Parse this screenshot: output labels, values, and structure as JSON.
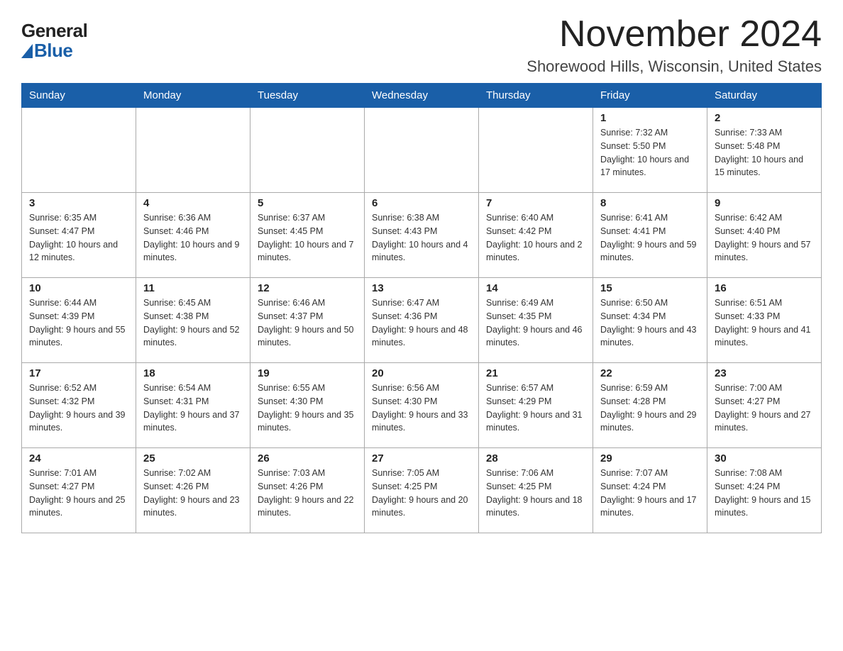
{
  "logo": {
    "general": "General",
    "blue": "Blue"
  },
  "header": {
    "month": "November 2024",
    "location": "Shorewood Hills, Wisconsin, United States"
  },
  "weekdays": [
    "Sunday",
    "Monday",
    "Tuesday",
    "Wednesday",
    "Thursday",
    "Friday",
    "Saturday"
  ],
  "weeks": [
    [
      {
        "day": "",
        "info": ""
      },
      {
        "day": "",
        "info": ""
      },
      {
        "day": "",
        "info": ""
      },
      {
        "day": "",
        "info": ""
      },
      {
        "day": "",
        "info": ""
      },
      {
        "day": "1",
        "info": "Sunrise: 7:32 AM\nSunset: 5:50 PM\nDaylight: 10 hours and 17 minutes."
      },
      {
        "day": "2",
        "info": "Sunrise: 7:33 AM\nSunset: 5:48 PM\nDaylight: 10 hours and 15 minutes."
      }
    ],
    [
      {
        "day": "3",
        "info": "Sunrise: 6:35 AM\nSunset: 4:47 PM\nDaylight: 10 hours and 12 minutes."
      },
      {
        "day": "4",
        "info": "Sunrise: 6:36 AM\nSunset: 4:46 PM\nDaylight: 10 hours and 9 minutes."
      },
      {
        "day": "5",
        "info": "Sunrise: 6:37 AM\nSunset: 4:45 PM\nDaylight: 10 hours and 7 minutes."
      },
      {
        "day": "6",
        "info": "Sunrise: 6:38 AM\nSunset: 4:43 PM\nDaylight: 10 hours and 4 minutes."
      },
      {
        "day": "7",
        "info": "Sunrise: 6:40 AM\nSunset: 4:42 PM\nDaylight: 10 hours and 2 minutes."
      },
      {
        "day": "8",
        "info": "Sunrise: 6:41 AM\nSunset: 4:41 PM\nDaylight: 9 hours and 59 minutes."
      },
      {
        "day": "9",
        "info": "Sunrise: 6:42 AM\nSunset: 4:40 PM\nDaylight: 9 hours and 57 minutes."
      }
    ],
    [
      {
        "day": "10",
        "info": "Sunrise: 6:44 AM\nSunset: 4:39 PM\nDaylight: 9 hours and 55 minutes."
      },
      {
        "day": "11",
        "info": "Sunrise: 6:45 AM\nSunset: 4:38 PM\nDaylight: 9 hours and 52 minutes."
      },
      {
        "day": "12",
        "info": "Sunrise: 6:46 AM\nSunset: 4:37 PM\nDaylight: 9 hours and 50 minutes."
      },
      {
        "day": "13",
        "info": "Sunrise: 6:47 AM\nSunset: 4:36 PM\nDaylight: 9 hours and 48 minutes."
      },
      {
        "day": "14",
        "info": "Sunrise: 6:49 AM\nSunset: 4:35 PM\nDaylight: 9 hours and 46 minutes."
      },
      {
        "day": "15",
        "info": "Sunrise: 6:50 AM\nSunset: 4:34 PM\nDaylight: 9 hours and 43 minutes."
      },
      {
        "day": "16",
        "info": "Sunrise: 6:51 AM\nSunset: 4:33 PM\nDaylight: 9 hours and 41 minutes."
      }
    ],
    [
      {
        "day": "17",
        "info": "Sunrise: 6:52 AM\nSunset: 4:32 PM\nDaylight: 9 hours and 39 minutes."
      },
      {
        "day": "18",
        "info": "Sunrise: 6:54 AM\nSunset: 4:31 PM\nDaylight: 9 hours and 37 minutes."
      },
      {
        "day": "19",
        "info": "Sunrise: 6:55 AM\nSunset: 4:30 PM\nDaylight: 9 hours and 35 minutes."
      },
      {
        "day": "20",
        "info": "Sunrise: 6:56 AM\nSunset: 4:30 PM\nDaylight: 9 hours and 33 minutes."
      },
      {
        "day": "21",
        "info": "Sunrise: 6:57 AM\nSunset: 4:29 PM\nDaylight: 9 hours and 31 minutes."
      },
      {
        "day": "22",
        "info": "Sunrise: 6:59 AM\nSunset: 4:28 PM\nDaylight: 9 hours and 29 minutes."
      },
      {
        "day": "23",
        "info": "Sunrise: 7:00 AM\nSunset: 4:27 PM\nDaylight: 9 hours and 27 minutes."
      }
    ],
    [
      {
        "day": "24",
        "info": "Sunrise: 7:01 AM\nSunset: 4:27 PM\nDaylight: 9 hours and 25 minutes."
      },
      {
        "day": "25",
        "info": "Sunrise: 7:02 AM\nSunset: 4:26 PM\nDaylight: 9 hours and 23 minutes."
      },
      {
        "day": "26",
        "info": "Sunrise: 7:03 AM\nSunset: 4:26 PM\nDaylight: 9 hours and 22 minutes."
      },
      {
        "day": "27",
        "info": "Sunrise: 7:05 AM\nSunset: 4:25 PM\nDaylight: 9 hours and 20 minutes."
      },
      {
        "day": "28",
        "info": "Sunrise: 7:06 AM\nSunset: 4:25 PM\nDaylight: 9 hours and 18 minutes."
      },
      {
        "day": "29",
        "info": "Sunrise: 7:07 AM\nSunset: 4:24 PM\nDaylight: 9 hours and 17 minutes."
      },
      {
        "day": "30",
        "info": "Sunrise: 7:08 AM\nSunset: 4:24 PM\nDaylight: 9 hours and 15 minutes."
      }
    ]
  ]
}
